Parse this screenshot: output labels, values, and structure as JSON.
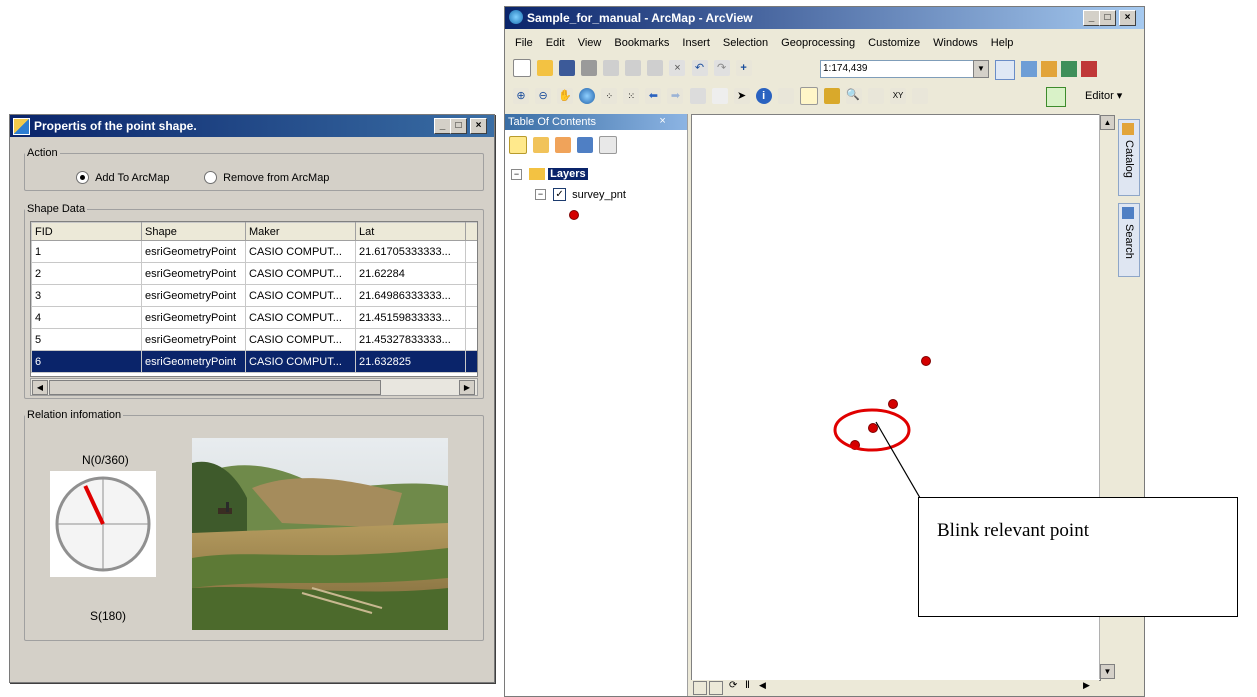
{
  "dialog": {
    "title": "Propertis of the point shape.",
    "action": {
      "legend": "Action",
      "option_add": "Add To ArcMap",
      "option_remove": "Remove from ArcMap",
      "selected": "Add To ArcMap"
    },
    "shape_data": {
      "legend": "Shape Data",
      "columns": [
        "FID",
        "Shape",
        "Maker",
        "Lat"
      ],
      "rows": [
        [
          "1",
          "esriGeometryPoint",
          "CASIO COMPUT...",
          "21.61705333333..."
        ],
        [
          "2",
          "esriGeometryPoint",
          "CASIO COMPUT...",
          "21.62284"
        ],
        [
          "3",
          "esriGeometryPoint",
          "CASIO COMPUT...",
          "21.64986333333..."
        ],
        [
          "4",
          "esriGeometryPoint",
          "CASIO COMPUT...",
          "21.45159833333..."
        ],
        [
          "5",
          "esriGeometryPoint",
          "CASIO COMPUT...",
          "21.45327833333..."
        ],
        [
          "6",
          "esriGeometryPoint",
          "CASIO COMPUT...",
          "21.632825"
        ]
      ],
      "selected_row": 6
    },
    "relation": {
      "legend": "Relation infomation",
      "north_label": "N(0/360)",
      "south_label": "S(180)",
      "heading_degrees": 335
    }
  },
  "arcmap": {
    "title": "Sample_for_manual - ArcMap - ArcView",
    "menu": [
      "File",
      "Edit",
      "View",
      "Bookmarks",
      "Insert",
      "Selection",
      "Geoprocessing",
      "Customize",
      "Windows",
      "Help"
    ],
    "scale": "1:174,439",
    "editor_label": "Editor",
    "toc": {
      "title": "Table Of Contents",
      "pin": "  ×",
      "layers_label": "Layers",
      "layer_name": "survey_pnt"
    },
    "side_tabs": [
      "Catalog",
      "Search"
    ]
  },
  "callout": {
    "text": "Blink relevant point"
  }
}
